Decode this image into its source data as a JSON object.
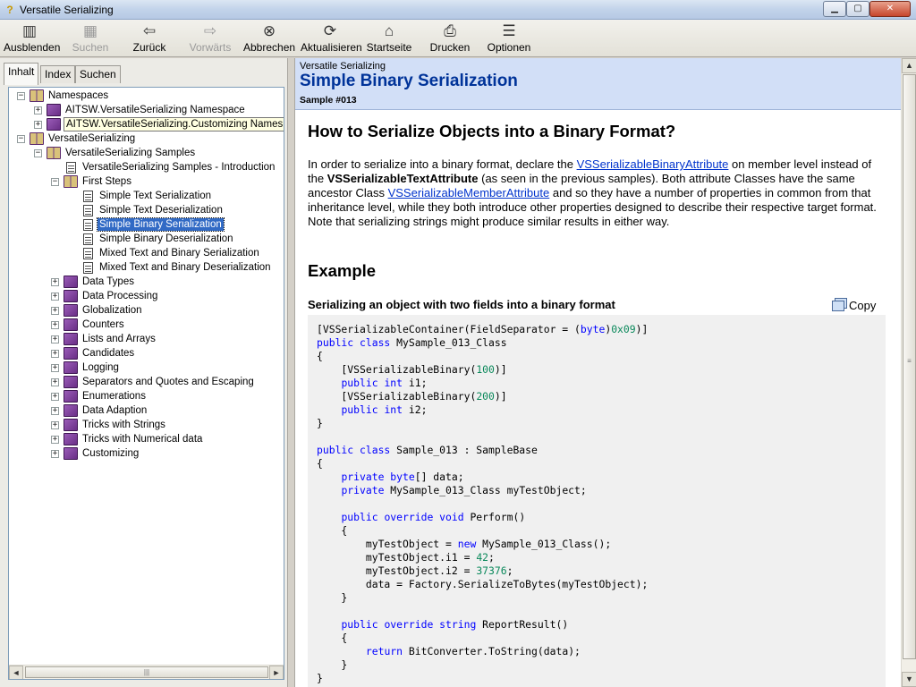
{
  "window": {
    "title": "Versatile Serializing",
    "min_glyph": "▁",
    "max_glyph": "▢",
    "close_glyph": "✕"
  },
  "toolbar": {
    "items": [
      {
        "label": "Ausblenden",
        "icon": "hide-pane-icon",
        "glyph": "▥",
        "enabled": true
      },
      {
        "label": "Suchen",
        "icon": "search-icon",
        "glyph": "▦",
        "enabled": false
      },
      {
        "label": "Zurück",
        "icon": "back-arrow-icon",
        "glyph": "⇦",
        "enabled": true
      },
      {
        "label": "Vorwärts",
        "icon": "forward-arrow-icon",
        "glyph": "⇨",
        "enabled": false
      },
      {
        "label": "Abbrechen",
        "icon": "stop-icon",
        "glyph": "⊗",
        "enabled": true
      },
      {
        "label": "Aktualisieren",
        "icon": "refresh-icon",
        "glyph": "⟳",
        "enabled": true
      },
      {
        "label": "Startseite",
        "icon": "home-icon",
        "glyph": "⌂",
        "enabled": true
      },
      {
        "label": "Drucken",
        "icon": "print-icon",
        "glyph": "⎙",
        "enabled": true
      },
      {
        "label": "Optionen",
        "icon": "options-icon",
        "glyph": "☰",
        "enabled": true
      }
    ]
  },
  "tabs": [
    {
      "label": "Inhalt",
      "active": true
    },
    {
      "label": "Index",
      "active": false
    },
    {
      "label": "Suchen",
      "active": false
    }
  ],
  "tree": [
    {
      "label": "Namespaces",
      "expander": "−",
      "icon": "book-open"
    },
    {
      "label": "AITSW.VersatileSerializing Namespace",
      "expander": "+",
      "icon": "book-closed"
    },
    {
      "label": "AITSW.VersatileSerializing.Customizing Namespace",
      "expander": "+",
      "icon": "book-closed"
    },
    {
      "label": "VersatileSerializing",
      "expander": "−",
      "icon": "book-open"
    },
    {
      "label": "VersatileSerializing Samples",
      "expander": "−",
      "icon": "book-open"
    },
    {
      "label": "VersatileSerializing Samples - Introduction",
      "expander": "",
      "icon": "page"
    },
    {
      "label": "First Steps",
      "expander": "−",
      "icon": "book-open"
    },
    {
      "label": "Simple Text Serialization",
      "expander": "",
      "icon": "page"
    },
    {
      "label": "Simple Text Deserialization",
      "expander": "",
      "icon": "page"
    },
    {
      "label": "Simple Binary Serialization",
      "expander": "",
      "icon": "page"
    },
    {
      "label": "Simple Binary Deserialization",
      "expander": "",
      "icon": "page"
    },
    {
      "label": "Mixed Text and Binary Serialization",
      "expander": "",
      "icon": "page"
    },
    {
      "label": "Mixed Text and Binary Deserialization",
      "expander": "",
      "icon": "page"
    },
    {
      "label": "Data Types",
      "expander": "+",
      "icon": "book-closed"
    },
    {
      "label": "Data Processing",
      "expander": "+",
      "icon": "book-closed"
    },
    {
      "label": "Globalization",
      "expander": "+",
      "icon": "book-closed"
    },
    {
      "label": "Counters",
      "expander": "+",
      "icon": "book-closed"
    },
    {
      "label": "Lists and Arrays",
      "expander": "+",
      "icon": "book-closed"
    },
    {
      "label": "Candidates",
      "expander": "+",
      "icon": "book-closed"
    },
    {
      "label": "Logging",
      "expander": "+",
      "icon": "book-closed"
    },
    {
      "label": "Separators and Quotes and Escaping",
      "expander": "+",
      "icon": "book-closed"
    },
    {
      "label": "Enumerations",
      "expander": "+",
      "icon": "book-closed"
    },
    {
      "label": "Data Adaption",
      "expander": "+",
      "icon": "book-closed"
    },
    {
      "label": "Tricks with Strings",
      "expander": "+",
      "icon": "book-closed"
    },
    {
      "label": "Tricks with Numerical data",
      "expander": "+",
      "icon": "book-closed"
    },
    {
      "label": "Customizing",
      "expander": "+",
      "icon": "book-closed"
    }
  ],
  "scroll": {
    "left_arrow": "◄",
    "right_arrow": "►",
    "up_arrow": "▲",
    "down_arrow": "▼",
    "grip": "|||",
    "vgrip": "≡"
  },
  "content": {
    "breadcrumb": "Versatile Serializing",
    "page_title": "Simple Binary Serialization",
    "sample_id": "Sample #013",
    "heading": "How to Serialize Objects into a Binary Format?",
    "para": {
      "t1": "In order to serialize into a binary format, declare the ",
      "link1": "VSSerializableBinaryAttribute",
      "t2": " on member level instead of the ",
      "bold1": "VSSerializableTextAttribute",
      "t3": " (as seen in the previous samples). Both attribute Classes have the same ancestor Class ",
      "link2": "VSSerializableMemberAttribute",
      "t4": " and so they have a number of properties in common from that inheritance level, while they both introduce other properties designed to describe their respective target format. Note that serializing strings might produce similar results in either way."
    },
    "example_heading": "Example",
    "snippet_title": "Serializing an object with two fields into a binary format",
    "copy_label": "Copy",
    "code": [
      [
        [
          "t",
          "[VSSerializableContainer(FieldSeparator = ("
        ],
        [
          "k",
          "byte"
        ],
        [
          "t",
          ")"
        ],
        [
          "n",
          "0x09"
        ],
        [
          "t",
          ")]"
        ]
      ],
      [
        [
          "k",
          "public class"
        ],
        [
          "t",
          " MySample_013_Class"
        ]
      ],
      [
        [
          "t",
          "{"
        ]
      ],
      [
        [
          "t",
          "    [VSSerializableBinary("
        ],
        [
          "n",
          "100"
        ],
        [
          "t",
          ")]"
        ]
      ],
      [
        [
          "t",
          "    "
        ],
        [
          "k",
          "public int"
        ],
        [
          "t",
          " i1;"
        ]
      ],
      [
        [
          "t",
          "    [VSSerializableBinary("
        ],
        [
          "n",
          "200"
        ],
        [
          "t",
          ")]"
        ]
      ],
      [
        [
          "t",
          "    "
        ],
        [
          "k",
          "public int"
        ],
        [
          "t",
          " i2;"
        ]
      ],
      [
        [
          "t",
          "}"
        ]
      ],
      [
        [
          "t",
          ""
        ]
      ],
      [
        [
          "k",
          "public class"
        ],
        [
          "t",
          " Sample_013 : SampleBase"
        ]
      ],
      [
        [
          "t",
          "{"
        ]
      ],
      [
        [
          "t",
          "    "
        ],
        [
          "k",
          "private byte"
        ],
        [
          "t",
          "[] data;"
        ]
      ],
      [
        [
          "t",
          "    "
        ],
        [
          "k",
          "private"
        ],
        [
          "t",
          " MySample_013_Class myTestObject;"
        ]
      ],
      [
        [
          "t",
          ""
        ]
      ],
      [
        [
          "t",
          "    "
        ],
        [
          "k",
          "public override void"
        ],
        [
          "t",
          " Perform()"
        ]
      ],
      [
        [
          "t",
          "    {"
        ]
      ],
      [
        [
          "t",
          "        myTestObject = "
        ],
        [
          "k",
          "new"
        ],
        [
          "t",
          " MySample_013_Class();"
        ]
      ],
      [
        [
          "t",
          "        myTestObject.i1 = "
        ],
        [
          "n",
          "42"
        ],
        [
          "t",
          ";"
        ]
      ],
      [
        [
          "t",
          "        myTestObject.i2 = "
        ],
        [
          "n",
          "37376"
        ],
        [
          "t",
          ";"
        ]
      ],
      [
        [
          "t",
          "        data = Factory.SerializeToBytes(myTestObject);"
        ]
      ],
      [
        [
          "t",
          "    }"
        ]
      ],
      [
        [
          "t",
          ""
        ]
      ],
      [
        [
          "t",
          "    "
        ],
        [
          "k",
          "public override string"
        ],
        [
          "t",
          " ReportResult()"
        ]
      ],
      [
        [
          "t",
          "    {"
        ]
      ],
      [
        [
          "t",
          "        "
        ],
        [
          "k",
          "return"
        ],
        [
          "t",
          " BitConverter.ToString(data);"
        ]
      ],
      [
        [
          "t",
          "    }"
        ]
      ],
      [
        [
          "t",
          "}"
        ]
      ]
    ]
  },
  "colors": {
    "banner": "#d2dff7",
    "title_blue": "#003399",
    "keyword": "#0000ff",
    "number": "#09885a",
    "selection": "#316ac5"
  }
}
